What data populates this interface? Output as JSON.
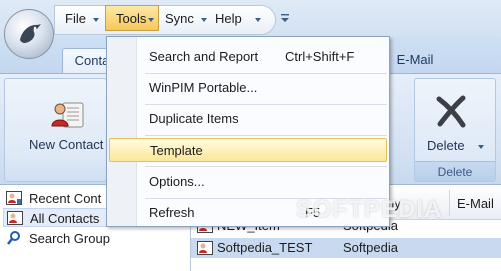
{
  "menubar": {
    "items": [
      {
        "label": "File"
      },
      {
        "label": "Tools"
      },
      {
        "label": "Sync"
      },
      {
        "label": "Help"
      }
    ]
  },
  "ribbon": {
    "tabs": [
      {
        "label": "Conta"
      },
      {
        "label": "E-Mail"
      }
    ],
    "new_contact_label": "New Contact",
    "delete_label": "Delete",
    "delete_group_label": "Delete"
  },
  "tools_menu": {
    "items": [
      {
        "label": "Search and Report",
        "shortcut": "Ctrl+Shift+F"
      },
      {
        "label": "WinPIM Portable..."
      },
      {
        "label": "Duplicate Items"
      },
      {
        "label": "Template"
      },
      {
        "label": "Options..."
      },
      {
        "label": "Refresh",
        "shortcut": "F5"
      }
    ]
  },
  "nav": {
    "items": [
      {
        "label": "Recent Cont"
      },
      {
        "label": "All Contacts"
      },
      {
        "label": "Search Group"
      }
    ]
  },
  "grid": {
    "columns": [
      {
        "label": "ny"
      },
      {
        "label": "E-Mail"
      }
    ],
    "rows": [
      {
        "name": "NEW_Item",
        "company": "Softpedia"
      },
      {
        "name": "Softpedia_TEST",
        "company": "Softpedia"
      }
    ]
  },
  "watermark": "SOFTPEDIA",
  "colors": {
    "menu_active": "#f6c85a",
    "ribbon_bg": "#d3e1f3",
    "selection": "#c9daf0",
    "hover_highlight": "#fbe79a"
  },
  "icons": [
    "app-orb-icon",
    "qat-customize-icon",
    "new-contact-icon",
    "delete-icon",
    "contact-card-icon",
    "search-icon"
  ]
}
